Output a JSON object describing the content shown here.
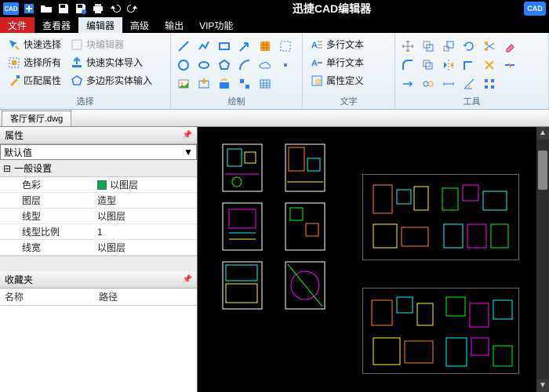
{
  "app": {
    "title": "迅捷CAD编辑器",
    "logo": "CAD",
    "right_badge": "CAD"
  },
  "menu": {
    "file": "文件",
    "tabs": [
      "查看器",
      "编辑器",
      "高级",
      "输出",
      "VIP功能"
    ],
    "active_index": 1
  },
  "ribbon": {
    "select": {
      "label": "选择",
      "quick_select": "快速选择",
      "select_all": "选择所有",
      "match_props": "匹配属性",
      "block_editor": "块编辑器",
      "fast_import": "快速实体导入",
      "polygon_input": "多边形实体输入"
    },
    "draw": {
      "label": "绘制"
    },
    "text": {
      "label": "文字",
      "multiline": "多行文本",
      "singleline": "单行文本",
      "attrdef": "属性定义"
    },
    "tools": {
      "label": "工具"
    }
  },
  "document": {
    "tab": "客厅餐厅.dwg"
  },
  "props": {
    "panel_title": "属性",
    "combo": "默认值",
    "section": "一般设置",
    "rows": [
      {
        "k": "色彩",
        "v": "以图层",
        "swatch": true
      },
      {
        "k": "图层",
        "v": "造型"
      },
      {
        "k": "线型",
        "v": "以图层"
      },
      {
        "k": "线型比例",
        "v": "1"
      },
      {
        "k": "线宽",
        "v": "以图层"
      }
    ]
  },
  "favorites": {
    "panel_title": "收藏夹",
    "cols": {
      "name": "名称",
      "path": "路径"
    }
  }
}
